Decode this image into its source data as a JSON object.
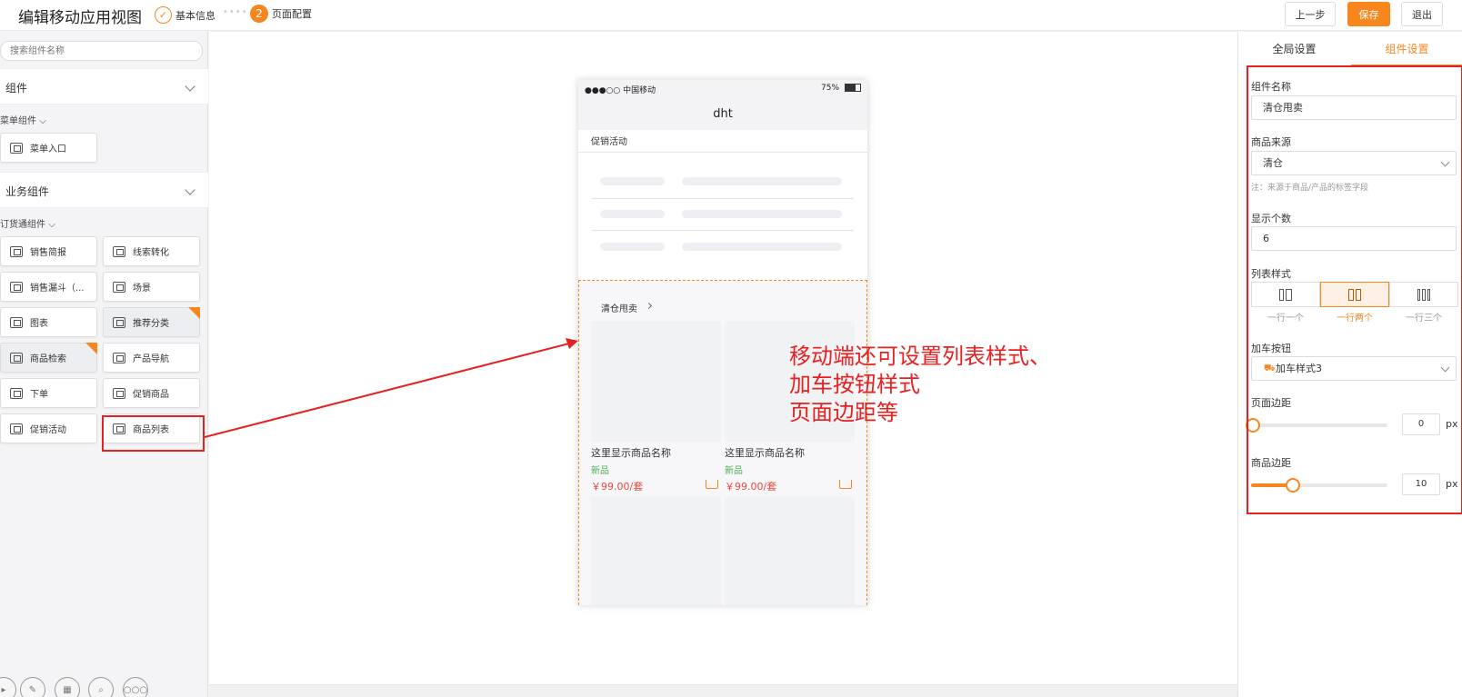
{
  "header": {
    "title": "编辑移动应用视图",
    "step1": {
      "label": "基本信息"
    },
    "step_separator": "••••",
    "step2": {
      "num": "2",
      "label": "页面配置"
    },
    "buttons": {
      "prev": "上一步",
      "save": "保存",
      "exit": "退出"
    }
  },
  "left": {
    "search_placeholder": "搜索组件名称",
    "sections": [
      {
        "title": "组件",
        "subheading": "菜单组件",
        "items": [
          "菜单入口"
        ]
      },
      {
        "title": "业务组件",
        "subheading": "订货通组件",
        "items": [
          "销售简报",
          "线索转化",
          "销售漏斗（...",
          "场景",
          "图表",
          "推荐分类",
          "商品检索",
          "产品导航",
          "下单",
          "促销商品",
          "促销活动",
          "商品列表"
        ]
      }
    ]
  },
  "phone": {
    "carrier": "●●●○○ 中国移动",
    "battery": "75%",
    "nav_title": "dht",
    "promo_title": "促销活动",
    "list_title": "清仓甩卖",
    "products": [
      {
        "name": "这里显示商品名称",
        "tag": "新品",
        "price": "￥99.00/套"
      },
      {
        "name": "这里显示商品名称",
        "tag": "新品",
        "price": "￥99.00/套"
      }
    ]
  },
  "annotation": {
    "line1": "移动端还可设置列表样式、",
    "line2": "加车按钮样式",
    "line3": "页面边距等"
  },
  "right": {
    "tabs": [
      "全局设置",
      "组件设置"
    ],
    "active_tab": 1,
    "fields": {
      "name_label": "组件名称",
      "name_value": "清仓甩卖",
      "source_label": "商品来源",
      "source_value": "清仓",
      "source_note": "注：来源于商品/产品的标签字段",
      "count_label": "显示个数",
      "count_value": "6",
      "style_label": "列表样式",
      "styles": [
        "一行一个",
        "一行两个",
        "一行三个"
      ],
      "active_style": 1,
      "cart_label": "加车按钮",
      "cart_value": "加车样式3",
      "page_margin_label": "页面边距",
      "page_margin_value": "0",
      "item_margin_label": "商品边距",
      "item_margin_value": "10",
      "unit": "px"
    }
  },
  "colors": {
    "accent": "#f7861f",
    "annotation_red": "#e62121"
  }
}
